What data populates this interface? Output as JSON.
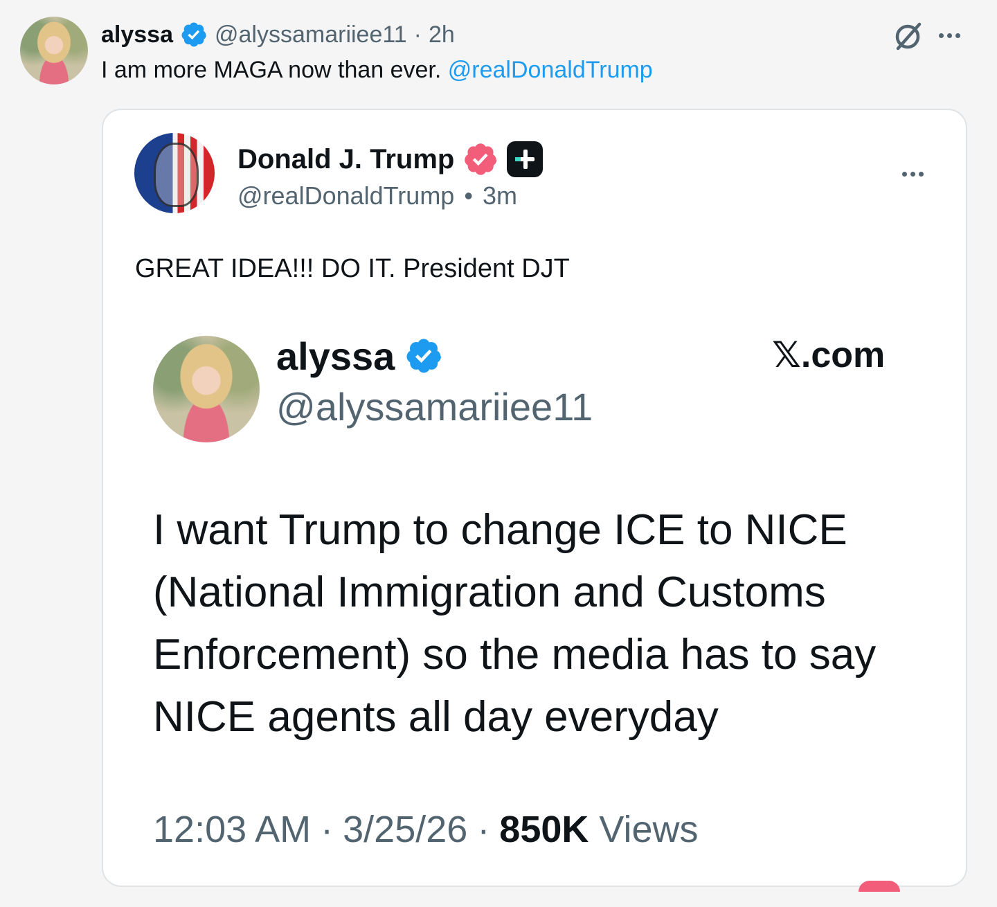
{
  "post": {
    "author": {
      "name": "alyssa",
      "handle": "@alyssamariiee11",
      "separator": "·",
      "time": "2h"
    },
    "text": "I am more MAGA now than ever.",
    "mention": "@realDonaldTrump",
    "icons": [
      "grok-icon",
      "more-icon"
    ]
  },
  "quoted": {
    "author": {
      "name": "Donald J. Trump",
      "handle": "@realDonaldTrump",
      "separator": "•",
      "time": "3m"
    },
    "text": "GREAT IDEA!!! DO IT. President DJT",
    "screenshot": {
      "name": "alyssa",
      "handle": "@alyssamariiee11",
      "brand": "𝕏.com",
      "lines": [
        "I want Trump to change ICE to NICE",
        "(National Immigration and Customs",
        "Enforcement) so the media has to say",
        "NICE agents all day everyday"
      ],
      "time": "12:03 AM",
      "dot": "·",
      "date": "3/25/26",
      "views_count": "850K",
      "views_label": "Views"
    }
  },
  "colors": {
    "background": "#f5f5f5",
    "link": "#1d9bf0",
    "verified_blue": "#1d9bf0",
    "verified_pink": "#f25d7a",
    "muted": "#536471"
  }
}
